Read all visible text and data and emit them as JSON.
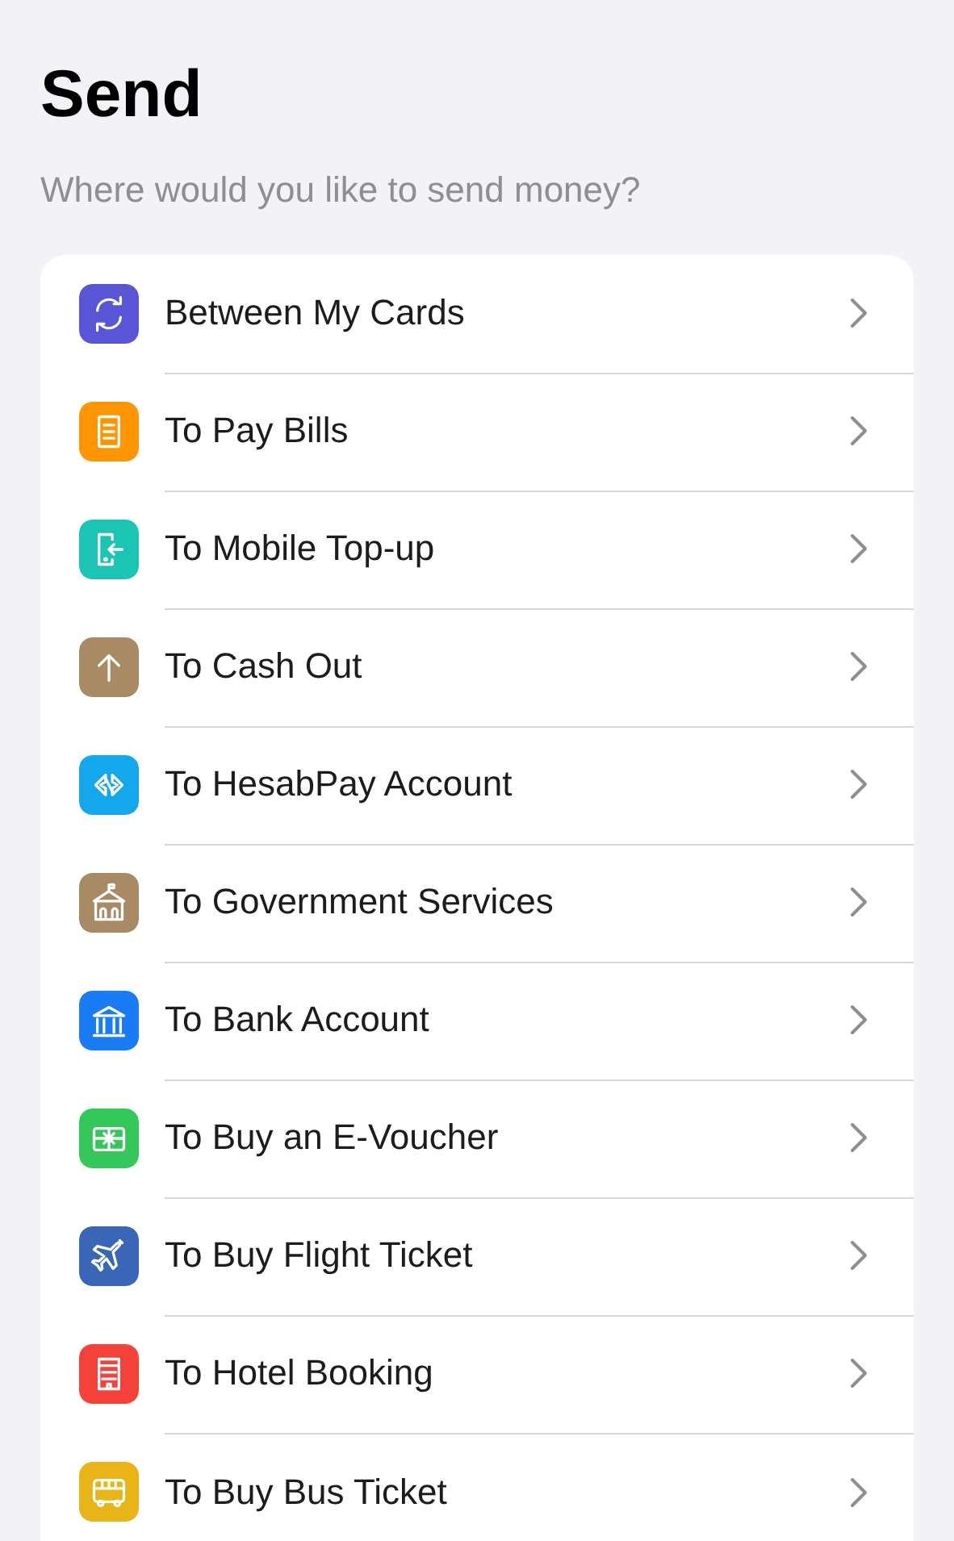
{
  "header": {
    "title": "Send",
    "subtitle": "Where would you like to send money?"
  },
  "options": [
    {
      "label": "Between My Cards",
      "color": "#5856d6"
    },
    {
      "label": "To Pay Bills",
      "color": "#ff9500"
    },
    {
      "label": "To Mobile Top-up",
      "color": "#1cc4b4"
    },
    {
      "label": "To Cash Out",
      "color": "#a88b64"
    },
    {
      "label": "To HesabPay Account",
      "color": "#14a7ec"
    },
    {
      "label": "To Government Services",
      "color": "#a88b64"
    },
    {
      "label": "To Bank Account",
      "color": "#1a7cf5"
    },
    {
      "label": "To Buy an E-Voucher",
      "color": "#34c759"
    },
    {
      "label": "To Buy Flight Ticket",
      "color": "#3a66b8"
    },
    {
      "label": "To Hotel Booking",
      "color": "#f4423a"
    },
    {
      "label": "To Buy Bus Ticket",
      "color": "#e9b416"
    }
  ]
}
